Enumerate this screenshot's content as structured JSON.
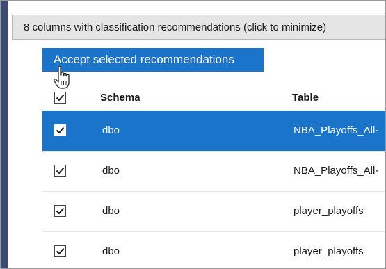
{
  "banner": {
    "text": "8 columns with classification recommendations (click to minimize)"
  },
  "accept_button": {
    "label": "Accept selected recommendations"
  },
  "table": {
    "headers": {
      "schema": "Schema",
      "table": "Table"
    },
    "select_all_checked": true,
    "rows": [
      {
        "schema": "dbo",
        "table": "NBA_Playoffs_All-",
        "checked": true,
        "selected": true
      },
      {
        "schema": "dbo",
        "table": "NBA_Playoffs_All-",
        "checked": true,
        "selected": false
      },
      {
        "schema": "dbo",
        "table": "player_playoffs",
        "checked": true,
        "selected": false
      },
      {
        "schema": "dbo",
        "table": "player_playoffs",
        "checked": true,
        "selected": false
      }
    ]
  },
  "colors": {
    "accent": "#1a74c9",
    "left_bar": "#3c4a76",
    "banner_bg": "#e5e5e5"
  }
}
